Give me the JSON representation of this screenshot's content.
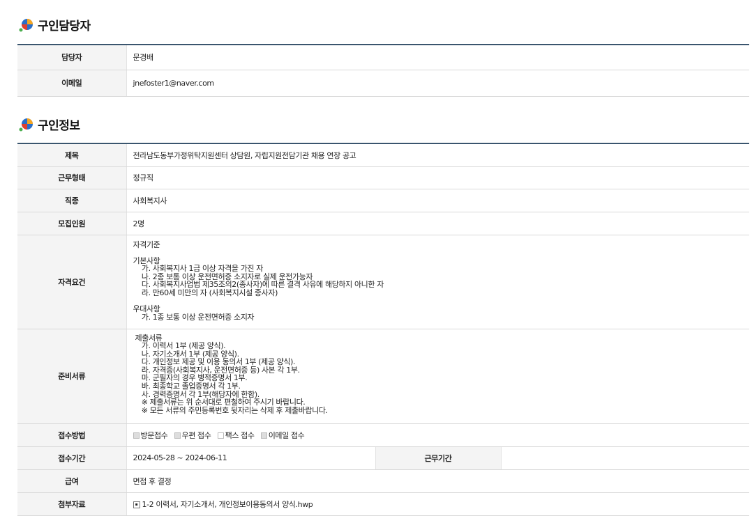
{
  "contact_section": {
    "title": "구인담당자",
    "rows": [
      {
        "label": "담당자",
        "value": "문경배"
      },
      {
        "label": "이메일",
        "value": "jnefoster1@naver.com"
      }
    ]
  },
  "job_section": {
    "title": "구인정보",
    "title_row": {
      "label": "제목",
      "value": "전라남도동부가정위탁지원센터 상담원, 자립지원전담기관 채용 연장 공고"
    },
    "work_type": {
      "label": "근무형태",
      "value": "정규직"
    },
    "occupation": {
      "label": "직종",
      "value": "사회복지사"
    },
    "headcount": {
      "label": "모집인원",
      "value": "2명"
    },
    "qualifications": {
      "label": "자격요건",
      "text": "자격기준\n\n기본사항\n    가. 사회복지사 1급 이상 자격을 가진 자\n    나. 2종 보통 이상 운전면허증 소지자로 실제 운전가능자\n    다. 사회복지사업법 제35조의2(종사자)에 따른 결격 사유에 해당하지 아니한 자\n    라. 만60세 미만의 자 (사회복지시설 종사자)\n\n우대사항\n    가. 1종 보통 이상 운전면허증 소지자"
    },
    "documents": {
      "label": "준비서류",
      "text": "제출서류\n   가. 이력서 1부 (제공 양식).\n   나. 자기소개서 1부 (제공 양식).\n   다. 개인정보 제공 및 이용 동의서 1부 (제공 양식).\n   라. 자격증(사회복지사, 운전면허증 등) 사본 각 1부.\n   마. 군필자의 경우 병적증명서 1부.\n   바. 최종학교 졸업증명서 각 1부.\n   사. 경력증명서 각 1부(해당자에 한함).\n   ※ 제출서류는 위 순서대로 편철하여 주시기 바랍니다.\n   ※ 모든 서류의 주민등록번호 뒷자리는 삭제 후 제출바랍니다."
    },
    "method": {
      "label": "접수방법",
      "options": [
        {
          "label": "방문접수",
          "checked": true
        },
        {
          "label": "우편 접수",
          "checked": true
        },
        {
          "label": "팩스 접수",
          "checked": false
        },
        {
          "label": "이메일 접수",
          "checked": true
        }
      ]
    },
    "period": {
      "label": "접수기간",
      "value": "2024-05-28 ~ 2024-06-11",
      "work_period_label": "근무기간",
      "work_period_value": ""
    },
    "salary": {
      "label": "급여",
      "value": "면접 후 결정"
    },
    "attachment": {
      "label": "첨부자료",
      "file": "1-2 이력서, 자기소개서, 개인정보이용동의서 양식.hwp"
    }
  }
}
